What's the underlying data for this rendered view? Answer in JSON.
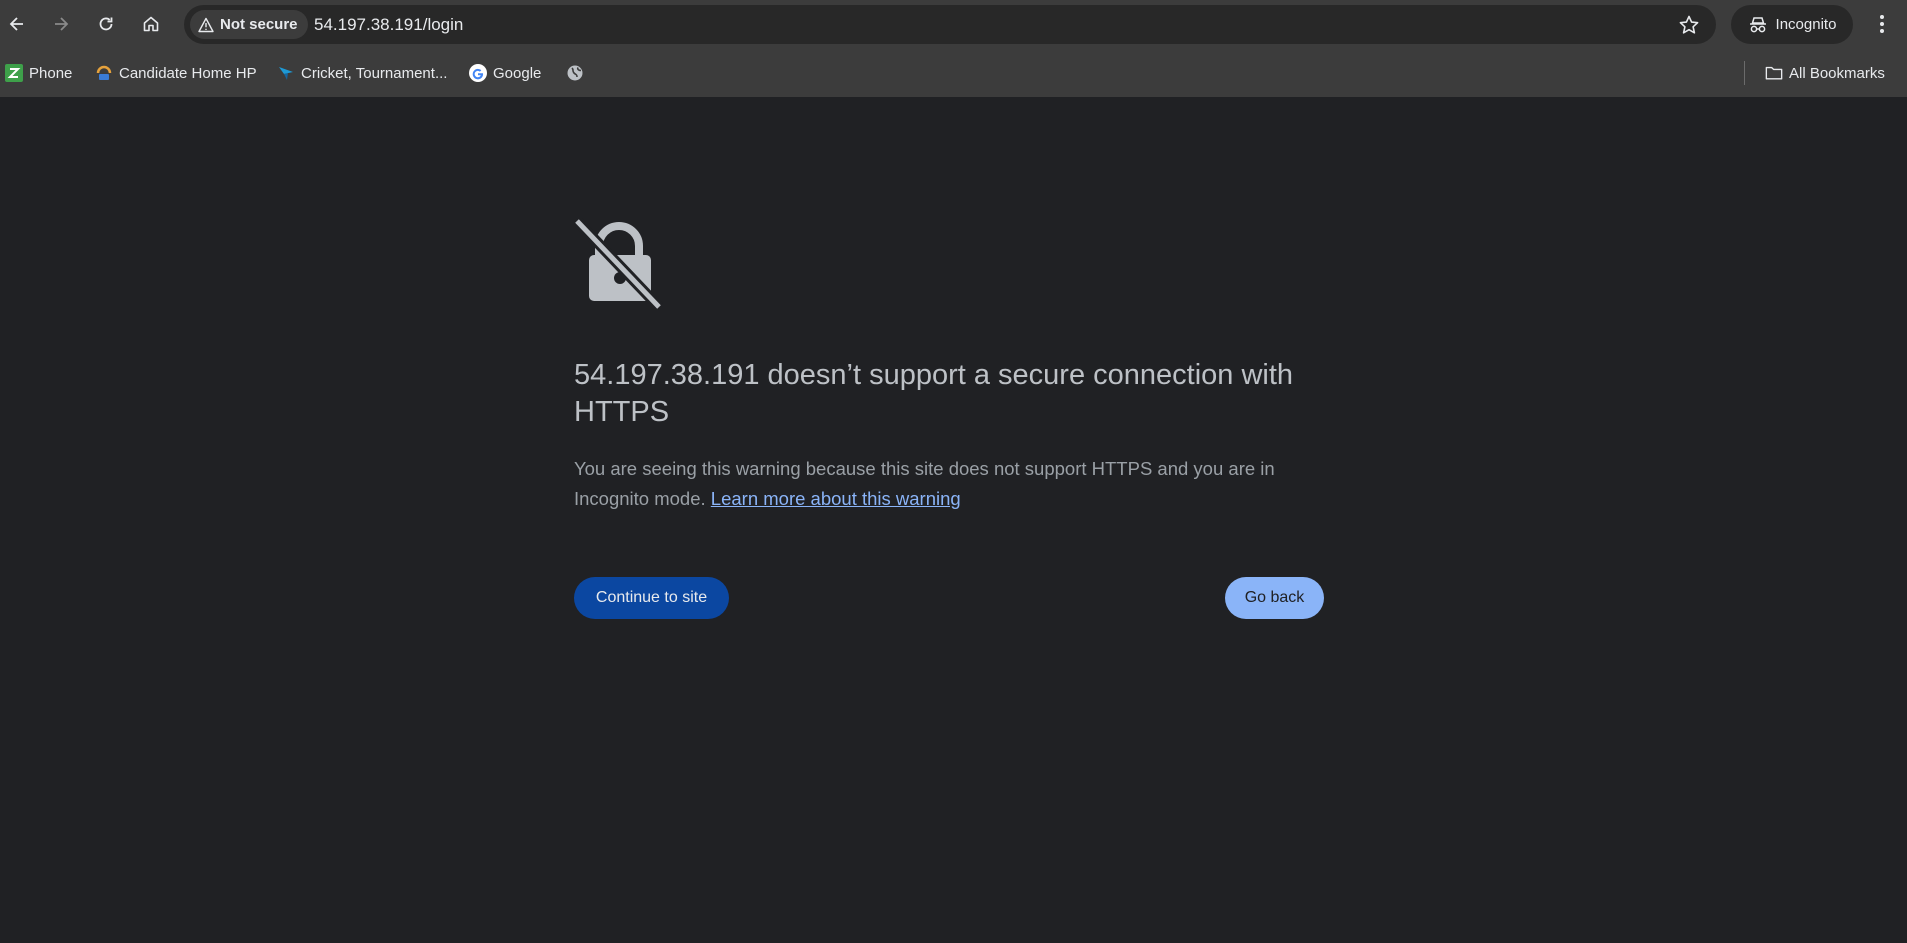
{
  "browser": {
    "security_label": "Not secure",
    "url": "54.197.38.191/login",
    "profile_label": "Incognito"
  },
  "bookmarks": {
    "items": [
      {
        "label": "Phone",
        "icon": "phone-app-icon",
        "color": "#3ea04a"
      },
      {
        "label": "Candidate Home HP",
        "icon": "candidate-logo-icon",
        "color": "#e6a23c"
      },
      {
        "label": "Cricket, Tournament...",
        "icon": "cricket-logo-icon",
        "color": "#1e9ad6"
      },
      {
        "label": "Google",
        "icon": "google-icon",
        "color": "#4285f4"
      },
      {
        "label": "",
        "icon": "globe-icon",
        "color": "#bdc1c6"
      }
    ],
    "all_bookmarks_label": "All Bookmarks"
  },
  "interstitial": {
    "icon": "broken-lock-icon",
    "title": "54.197.38.191 doesn’t support a secure connection with HTTPS",
    "description": "You are seeing this warning because this site does not support HTTPS and you are in Incognito mode.",
    "learn_more": "Learn more about this warning",
    "continue_label": "Continue to site",
    "back_label": "Go back"
  },
  "colors": {
    "page_bg": "#202124",
    "toolbar_bg": "#3c3c3c",
    "primary_button": "#0b47a1",
    "secondary_button": "#8ab4f8",
    "link": "#8ab4f8"
  }
}
